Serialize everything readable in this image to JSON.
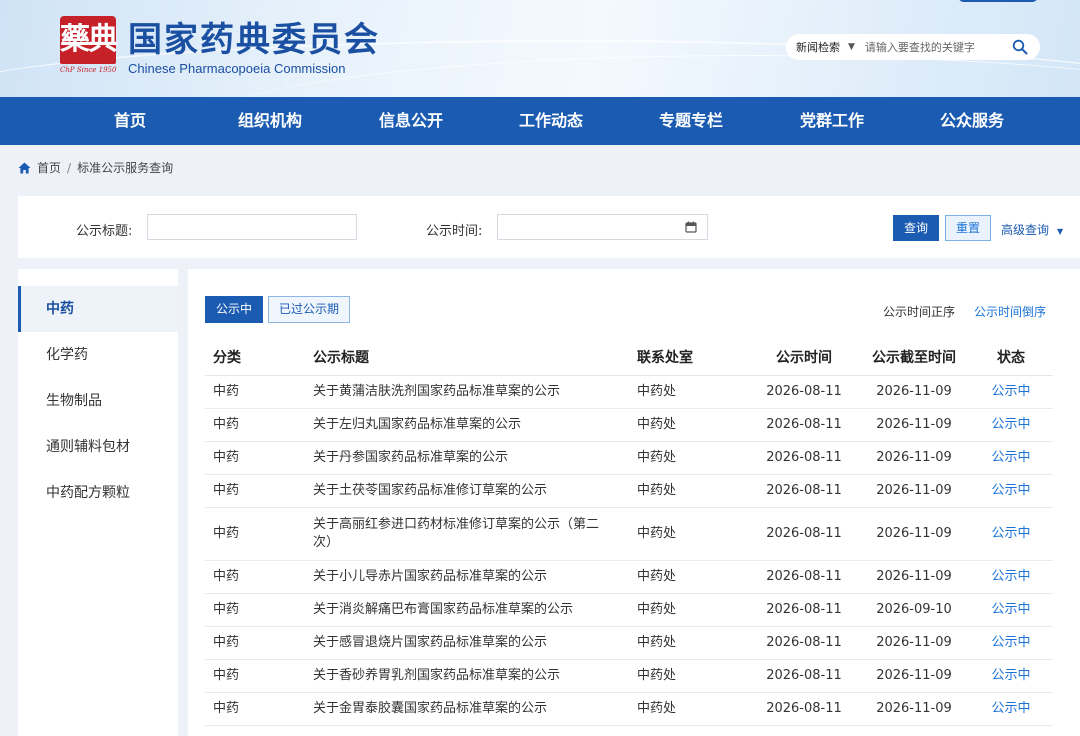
{
  "header": {
    "seal_glyph": "藥典",
    "seal_caption": "ChP Since 1950",
    "title_cn": "国家药典委员会",
    "title_en": "Chinese Pharmacopoeia Commission",
    "search": {
      "scope": "新闻检索",
      "placeholder": "请输入要查找的关键字"
    }
  },
  "nav": [
    "首页",
    "组织机构",
    "信息公开",
    "工作动态",
    "专题专栏",
    "党群工作",
    "公众服务"
  ],
  "breadcrumb": {
    "home": "首页",
    "sep": "/",
    "current": "标准公示服务查询"
  },
  "filter": {
    "title_label": "公示标题:",
    "title_value": "",
    "time_label": "公示时间:",
    "time_value": "",
    "query_btn": "查询",
    "reset_btn": "重置",
    "advanced": "高级查询"
  },
  "sidebar": [
    "中药",
    "化学药",
    "生物制品",
    "通则辅料包材",
    "中药配方颗粒"
  ],
  "tabs": {
    "active": "公示中",
    "inactive": "已过公示期"
  },
  "sort": {
    "asc": "公示时间正序",
    "desc": "公示时间倒序"
  },
  "table": {
    "headers": [
      "分类",
      "公示标题",
      "联系处室",
      "公示时间",
      "公示截至时间",
      "状态"
    ],
    "rows": [
      [
        "中药",
        "关于黄蒲洁肤洗剂国家药品标准草案的公示",
        "中药处",
        "2026-08-11",
        "2026-11-09",
        "公示中"
      ],
      [
        "中药",
        "关于左归丸国家药品标准草案的公示",
        "中药处",
        "2026-08-11",
        "2026-11-09",
        "公示中"
      ],
      [
        "中药",
        "关于丹参国家药品标准草案的公示",
        "中药处",
        "2026-08-11",
        "2026-11-09",
        "公示中"
      ],
      [
        "中药",
        "关于土茯苓国家药品标准修订草案的公示",
        "中药处",
        "2026-08-11",
        "2026-11-09",
        "公示中"
      ],
      [
        "中药",
        "关于高丽红参进口药材标准修订草案的公示（第二次）",
        "中药处",
        "2026-08-11",
        "2026-11-09",
        "公示中"
      ],
      [
        "中药",
        "关于小儿导赤片国家药品标准草案的公示",
        "中药处",
        "2026-08-11",
        "2026-11-09",
        "公示中"
      ],
      [
        "中药",
        "关于消炎解痛巴布膏国家药品标准草案的公示",
        "中药处",
        "2026-08-11",
        "2026-09-10",
        "公示中"
      ],
      [
        "中药",
        "关于感冒退烧片国家药品标准草案的公示",
        "中药处",
        "2026-08-11",
        "2026-11-09",
        "公示中"
      ],
      [
        "中药",
        "关于香砂养胃乳剂国家药品标准草案的公示",
        "中药处",
        "2026-08-11",
        "2026-11-09",
        "公示中"
      ],
      [
        "中药",
        "关于金胃泰胶囊国家药品标准草案的公示",
        "中药处",
        "2026-08-11",
        "2026-11-09",
        "公示中"
      ]
    ]
  },
  "colors": {
    "brand_blue": "#1b5bb1",
    "link_blue": "#1b73d6",
    "seal_red": "#c62029"
  }
}
